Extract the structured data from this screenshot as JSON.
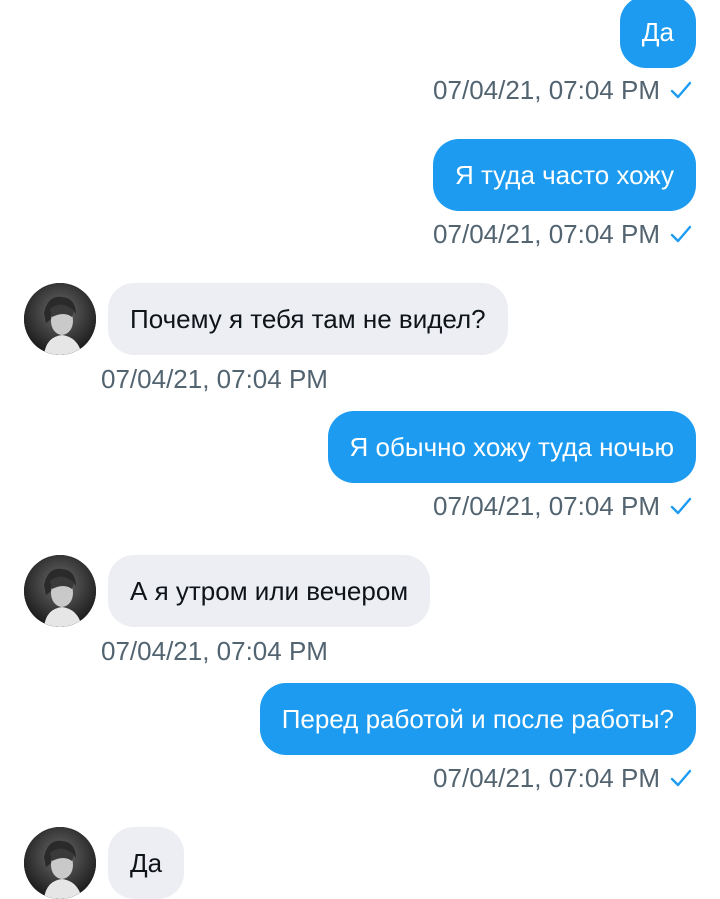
{
  "messages": [
    {
      "direction": "out",
      "text": "Да",
      "time": "07/04/21, 07:04 PM",
      "read": true
    },
    {
      "direction": "out",
      "text": "Я туда часто хожу",
      "time": "07/04/21, 07:04 PM",
      "read": true
    },
    {
      "direction": "in",
      "text": "Почему я тебя там не видел?",
      "time": "07/04/21, 07:04 PM",
      "avatar_icon": "user-avatar"
    },
    {
      "direction": "out",
      "text": "Я обычно хожу туда ночью",
      "time": "07/04/21, 07:04 PM",
      "read": true
    },
    {
      "direction": "in",
      "text": "А я утром или вечером",
      "time": "07/04/21, 07:04 PM",
      "avatar_icon": "user-avatar"
    },
    {
      "direction": "out",
      "text": "Перед работой и после работы?",
      "time": "07/04/21, 07:04 PM",
      "read": true
    },
    {
      "direction": "in",
      "text": "Да",
      "time": "",
      "avatar_icon": "user-avatar"
    }
  ],
  "colors": {
    "outgoing_bubble": "#1d9bf0",
    "incoming_bubble": "#eceef3",
    "timestamp": "#536471",
    "read_check": "#1d9bf0"
  }
}
